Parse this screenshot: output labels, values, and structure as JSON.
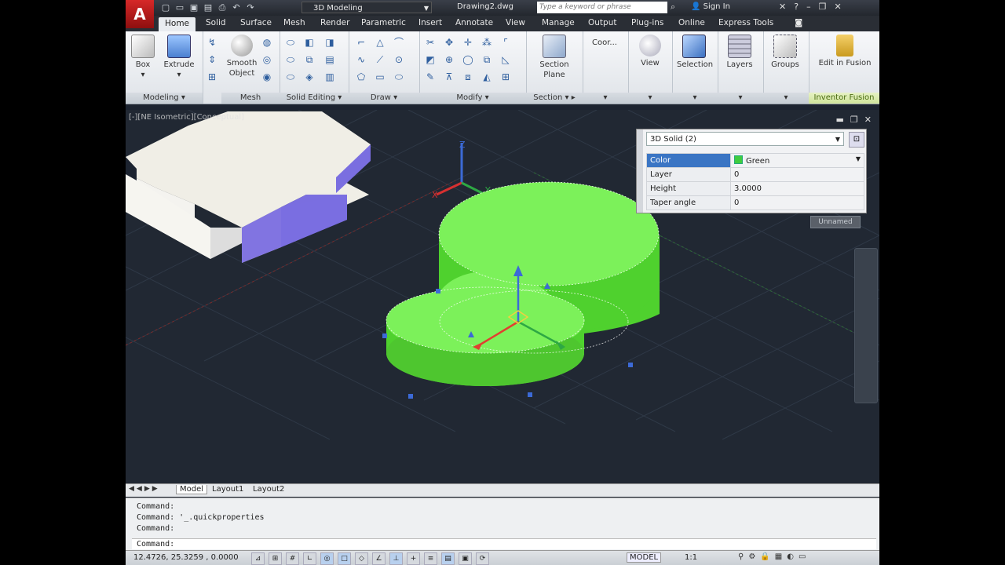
{
  "app": {
    "logo": "A",
    "workspace": "3D Modeling",
    "document": "Drawing2.dwg",
    "search_placeholder": "Type a keyword or phrase",
    "sign_in": "Sign In"
  },
  "tabs": [
    "Home",
    "Solid",
    "Surface",
    "Mesh",
    "Render",
    "Parametric",
    "Insert",
    "Annotate",
    "View",
    "Manage",
    "Output",
    "Plug-ins",
    "Online",
    "Express Tools"
  ],
  "active_tab": "Home",
  "ribbon": {
    "box": "Box",
    "extrude": "Extrude",
    "smooth_object_1": "Smooth",
    "smooth_object_2": "Object",
    "section_plane_1": "Section",
    "section_plane_2": "Plane",
    "coordinates": "Coor...",
    "view": "View",
    "selection": "Selection",
    "layers": "Layers",
    "groups": "Groups",
    "edit_in_fusion": "Edit in Fusion",
    "panels": {
      "modeling": "Modeling",
      "mesh": "Mesh",
      "solid_editing": "Solid Editing",
      "draw": "Draw",
      "modify": "Modify",
      "section": "Section",
      "inventor_fusion": "Inventor Fusion"
    }
  },
  "viewport": {
    "label": "[-][NE Isometric][Conceptual]",
    "axis_x": "X",
    "axis_y": "Y",
    "axis_z": "Z",
    "unnamed": "Unnamed"
  },
  "quick_properties": {
    "object_type": "3D Solid (2)",
    "rows": [
      {
        "key": "Color",
        "value": "Green"
      },
      {
        "key": "Layer",
        "value": "0"
      },
      {
        "key": "Height",
        "value": "3.0000"
      },
      {
        "key": "Taper angle",
        "value": "0"
      }
    ]
  },
  "layout_tabs": [
    "Model",
    "Layout1",
    "Layout2"
  ],
  "command_history": [
    "Command:",
    "Command:  '_.quickproperties",
    "Command:"
  ],
  "command_prompt": "Command:",
  "status": {
    "coords": "12.4726, 25.3259 , 0.0000",
    "model": "MODEL",
    "scale": "1:1"
  },
  "colors": {
    "solid_top": "#7cf15a",
    "solid_side": "#4fd12e",
    "box_top": "#f0eee6",
    "box_side": "#7a6ee0",
    "background": "#212833"
  }
}
